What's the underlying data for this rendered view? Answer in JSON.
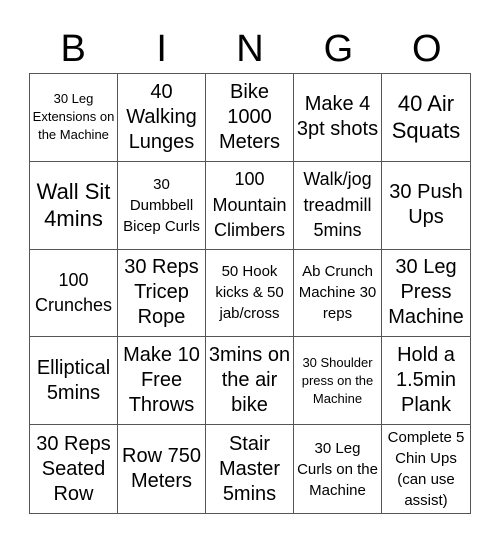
{
  "header": {
    "letters": [
      "B",
      "I",
      "N",
      "G",
      "O"
    ]
  },
  "cells": [
    {
      "text": "30 Leg Extensions on the Machine",
      "size": "s1"
    },
    {
      "text": "40 Walking Lunges",
      "size": "s4"
    },
    {
      "text": "Bike 1000 Meters",
      "size": "s4"
    },
    {
      "text": "Make 4 3pt shots",
      "size": "s4"
    },
    {
      "text": "40 Air Squats",
      "size": "s5"
    },
    {
      "text": "Wall Sit 4mins",
      "size": "s5"
    },
    {
      "text": "30 Dumbbell Bicep Curls",
      "size": "s2"
    },
    {
      "text": "100 Mountain Climbers",
      "size": "s3"
    },
    {
      "text": "Walk/jog treadmill 5mins",
      "size": "s3"
    },
    {
      "text": "30 Push Ups",
      "size": "s4"
    },
    {
      "text": "100 Crunches",
      "size": "s3"
    },
    {
      "text": "30 Reps Tricep Rope",
      "size": "s4"
    },
    {
      "text": "50 Hook kicks & 50 jab/cross",
      "size": "s2"
    },
    {
      "text": "Ab Crunch Machine 30 reps",
      "size": "s2"
    },
    {
      "text": "30 Leg Press Machine",
      "size": "s4"
    },
    {
      "text": "Elliptical 5mins",
      "size": "s4"
    },
    {
      "text": "Make 10 Free Throws",
      "size": "s4"
    },
    {
      "text": "3mins on the air bike",
      "size": "s4"
    },
    {
      "text": "30 Shoulder press on the Machine",
      "size": "s1"
    },
    {
      "text": "Hold a 1.5min Plank",
      "size": "s4"
    },
    {
      "text": "30 Reps Seated Row",
      "size": "s4"
    },
    {
      "text": "Row 750 Meters",
      "size": "s4"
    },
    {
      "text": "Stair Master 5mins",
      "size": "s4"
    },
    {
      "text": "30 Leg Curls on the Machine",
      "size": "s2"
    },
    {
      "text": "Complete 5 Chin Ups (can use assist)",
      "size": "s2"
    }
  ]
}
